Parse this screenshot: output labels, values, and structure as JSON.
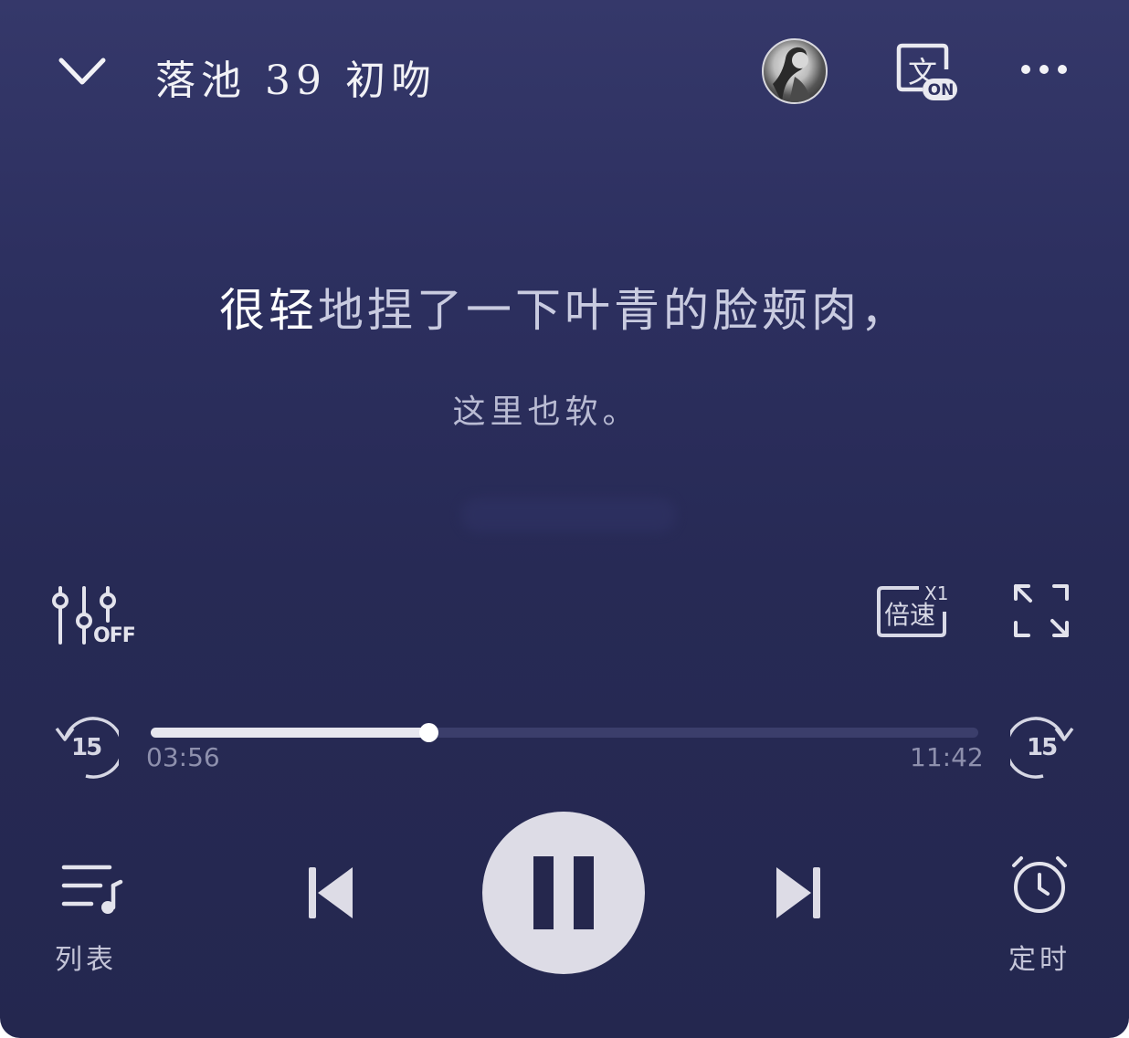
{
  "header": {
    "title": "落池 39 初吻",
    "collapse_icon": "chevron-down-icon",
    "avatar_icon": "author-avatar",
    "translate_icon": "translate-toggle-icon",
    "translate_char": "文",
    "translate_badge": "ON",
    "more_icon": "more-dots-icon"
  },
  "lyrics": {
    "current_sung": "很轻",
    "current_rest": "地捏了一下叶青的脸颊肉，",
    "next": "这里也软。"
  },
  "controls": {
    "sound_effect": {
      "icon": "equalizer-icon",
      "badge": "OFF"
    },
    "speed": {
      "icon": "speed-icon",
      "label": "倍速",
      "value": "X1"
    },
    "fullscreen_icon": "fullscreen-icon"
  },
  "progress": {
    "elapsed": "03:56",
    "total": "11:42",
    "fraction": 0.336,
    "rewind_label": "15",
    "forward_label": "15"
  },
  "player": {
    "playlist": {
      "icon": "playlist-icon",
      "label": "列表"
    },
    "prev_icon": "skip-previous-icon",
    "play_icon": "pause-icon",
    "next_icon": "skip-next-icon",
    "timer": {
      "icon": "alarm-clock-icon",
      "label": "定时"
    }
  },
  "colors": {
    "background_top": "#35386a",
    "background_bottom": "#24274f",
    "accent": "#e6e6ee"
  }
}
